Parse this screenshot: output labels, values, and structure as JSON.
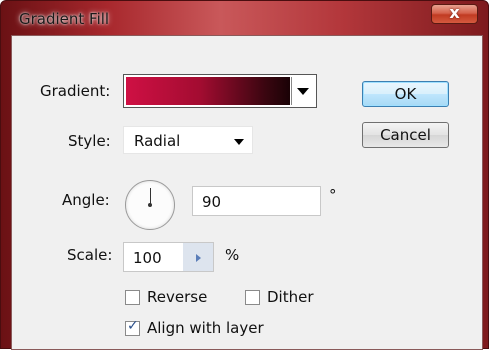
{
  "window": {
    "title": "Gradient Fill",
    "close_glyph": "x"
  },
  "gradient": {
    "label": "Gradient:",
    "colors": [
      "#cf1044",
      "#a30c31",
      "#1a0206"
    ]
  },
  "style": {
    "label": "Style:",
    "value": "Radial"
  },
  "angle": {
    "label": "Angle:",
    "value": "90",
    "unit": "°"
  },
  "scale": {
    "label": "Scale:",
    "value": "100",
    "unit": "%"
  },
  "checkboxes": {
    "reverse": {
      "label": "Reverse",
      "checked": false
    },
    "dither": {
      "label": "Dither",
      "checked": false
    },
    "align": {
      "label": "Align with layer",
      "checked": true
    }
  },
  "buttons": {
    "ok": "OK",
    "cancel": "Cancel"
  }
}
